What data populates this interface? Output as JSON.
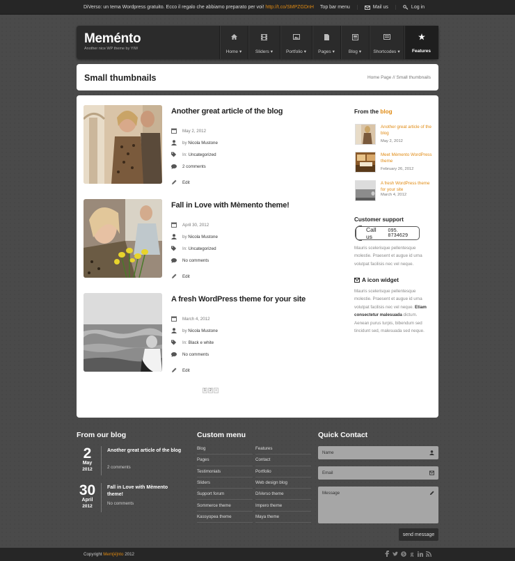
{
  "topbar": {
    "message": "DiVerso: un tema Wordpress gratuito. Ecco il regalo che abbiamo preparato per voi!",
    "link": "http://t.co/SMPZGDnH",
    "menu_label": "Top bar menu",
    "mail_label": "Mail us",
    "login_label": "Log in"
  },
  "header": {
    "logo": "Meménto",
    "tagline": "Another nice WP theme by YIW",
    "nav": [
      {
        "label": "Home",
        "icon": "home-icon"
      },
      {
        "label": "Sliders",
        "icon": "film-icon"
      },
      {
        "label": "Portfolio",
        "icon": "image-icon"
      },
      {
        "label": "Pages",
        "icon": "page-icon"
      },
      {
        "label": "Blog",
        "icon": "blog-icon"
      },
      {
        "label": "Shortcodes",
        "icon": "shortcodes-icon"
      },
      {
        "label": "Features",
        "icon": "star-icon"
      }
    ]
  },
  "page": {
    "title": "Small thumbnails",
    "breadcrumb": "Home Page // Small thumbnails"
  },
  "posts": [
    {
      "title": "Another great article of the blog",
      "date": "May 2, 2012",
      "author_prefix": "by",
      "author": "Nicola Mustone",
      "cat_prefix": "In:",
      "category": "Uncategorized",
      "comments": "2 comments",
      "edit": "Edit"
    },
    {
      "title": "Fall in Love with Mèmento theme!",
      "date": "April 30, 2012",
      "author_prefix": "by",
      "author": "Nicola Mustone",
      "cat_prefix": "In:",
      "category": "Uncategorized",
      "comments": "No comments",
      "edit": "Edit"
    },
    {
      "title": "A fresh WordPress theme for your site",
      "date": "March 4, 2012",
      "author_prefix": "by",
      "author": "Nicola Mustone",
      "cat_prefix": "In:",
      "category": "Black e white",
      "comments": "No comments",
      "edit": "Edit"
    }
  ],
  "pagination": [
    "1",
    "2",
    "›"
  ],
  "sidebar": {
    "blog_title_pre": "From the",
    "blog_title_hl": "blog",
    "blog_posts": [
      {
        "title": "Another great article of the blog",
        "date": "May 2, 2012"
      },
      {
        "title": "Meet Mèmento WordPress theme",
        "date": "February 26, 2012"
      },
      {
        "title": "A fresh WordPress theme for your site",
        "date": "March 4, 2012"
      }
    ],
    "support_title": "Customer support",
    "call_label": "Call us",
    "call_number": "095. 8734629",
    "support_text": "Mauris scelerisque pellentesque molestie. Praesent et augue id urna volutpat facilisis nec vel neque.",
    "icon_widget_title": "A icon widget",
    "icon_text_1": "Mauris scelerisque pellentesque molestie. Praesent et augue id urna volutpat facilisis nec vel neque.",
    "icon_text_bold": "Etiam consectetur malesuada",
    "icon_text_2": "dictum. Aenean purus turpis, bibendum sed tincidunt sed, malesuada sed neque."
  },
  "footer": {
    "blog_title": "From our blog",
    "blog_posts": [
      {
        "day": "2",
        "month": "May",
        "year": "2012",
        "title": "Another great article of the blog",
        "comments": "2 comments"
      },
      {
        "day": "30",
        "month": "April",
        "year": "2012",
        "title": "Fall in Love with Mèmento theme!",
        "comments": "No comments"
      }
    ],
    "menu_title": "Custom menu",
    "menu_items": [
      "Blog",
      "Features",
      "Pages",
      "Contact",
      "Testimonials",
      "Portfolio",
      "Sliders",
      "Web design blog",
      "Support forum",
      "DiVerso theme",
      "Sommerce theme",
      "Impero theme",
      "Kassyopea theme",
      "Maya theme"
    ],
    "contact_title": "Quick Contact",
    "name_placeholder": "Name",
    "email_placeholder": "Email",
    "message_placeholder": "Message",
    "send_label": "send message"
  },
  "bottombar": {
    "copyright_pre": "Copyright",
    "brand": "Mem[é]nto",
    "year": "2012",
    "social": [
      "facebook-icon",
      "twitter-icon",
      "skype-icon",
      "google-icon",
      "linkedin-icon",
      "rss-icon"
    ]
  },
  "colors": {
    "accent": "#e08a12",
    "background": "#4a4a4a",
    "dark": "#262626"
  }
}
